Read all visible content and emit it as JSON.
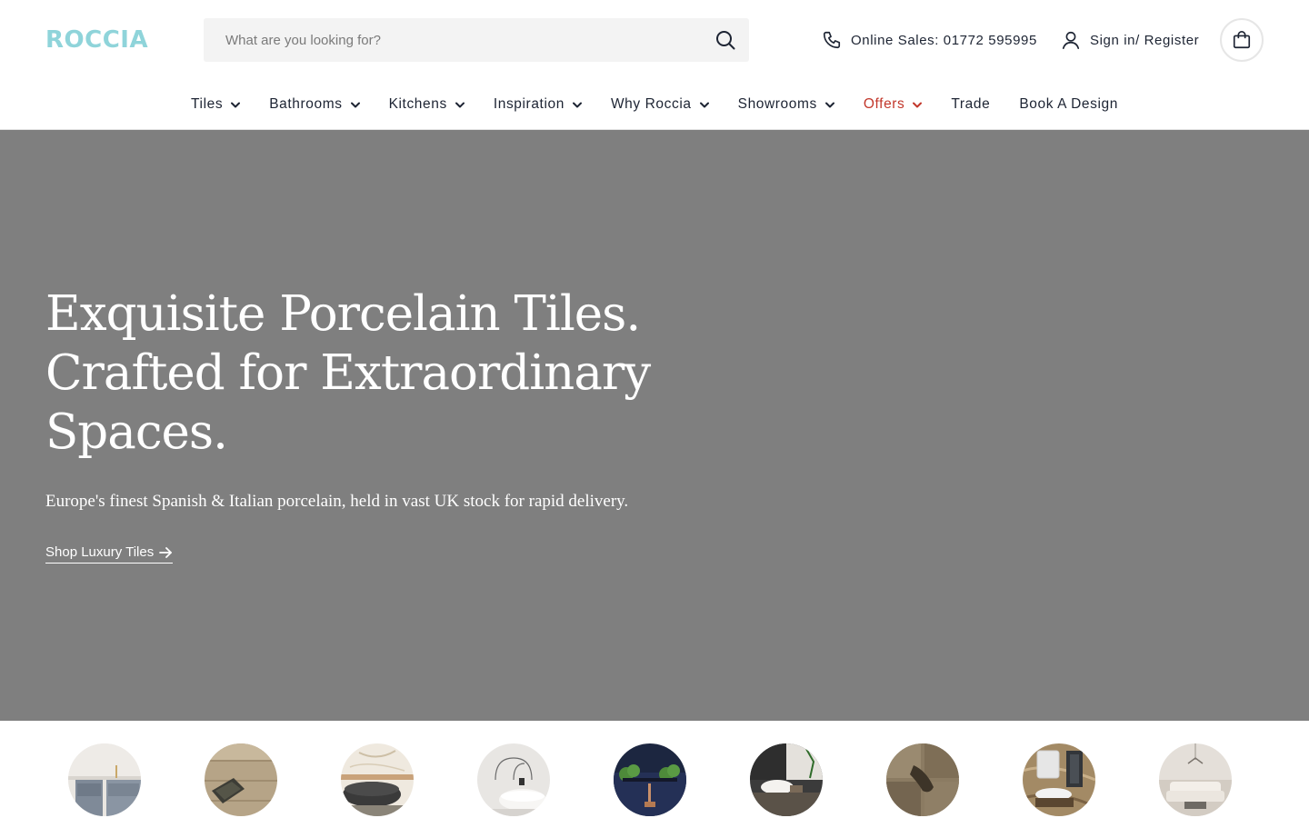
{
  "brand": {
    "logo_text": "ROCCIA",
    "color": "#8fd4da"
  },
  "search": {
    "placeholder": "What are you looking for?",
    "value": "",
    "icon": "search-icon"
  },
  "contact": {
    "phone_label": "Online Sales: 01772 595995",
    "icon": "phone-icon"
  },
  "account": {
    "label": "Sign in/ Register",
    "icon": "user-icon"
  },
  "cart": {
    "icon": "shopping-bag-icon"
  },
  "nav": {
    "items": [
      {
        "label": "Tiles",
        "has_dropdown": true
      },
      {
        "label": "Bathrooms",
        "has_dropdown": true
      },
      {
        "label": "Kitchens",
        "has_dropdown": true
      },
      {
        "label": "Inspiration",
        "has_dropdown": true
      },
      {
        "label": "Why Roccia",
        "has_dropdown": true
      },
      {
        "label": "Showrooms",
        "has_dropdown": true
      },
      {
        "label": "Offers",
        "has_dropdown": true,
        "accent": "#c2372b"
      },
      {
        "label": "Trade",
        "has_dropdown": false
      },
      {
        "label": "Book A Design",
        "has_dropdown": false
      }
    ]
  },
  "hero": {
    "headline_lines": [
      "Exquisite Porcelain Tiles.",
      "Crafted for Extraordinary",
      "Spaces."
    ],
    "subtext": "Europe's finest Spanish & Italian porcelain, held in vast UK stock for rapid delivery.",
    "cta_label": "Shop Luxury Tiles",
    "background": "#7f7f7f"
  },
  "categories": [
    {
      "name": "kitchen-cabinets"
    },
    {
      "name": "wood-floor"
    },
    {
      "name": "freestanding-bath"
    },
    {
      "name": "white-bathroom"
    },
    {
      "name": "dark-wall-plants"
    },
    {
      "name": "stone-basin"
    },
    {
      "name": "rustic-stone"
    },
    {
      "name": "marble-bathroom"
    },
    {
      "name": "living-room"
    }
  ]
}
